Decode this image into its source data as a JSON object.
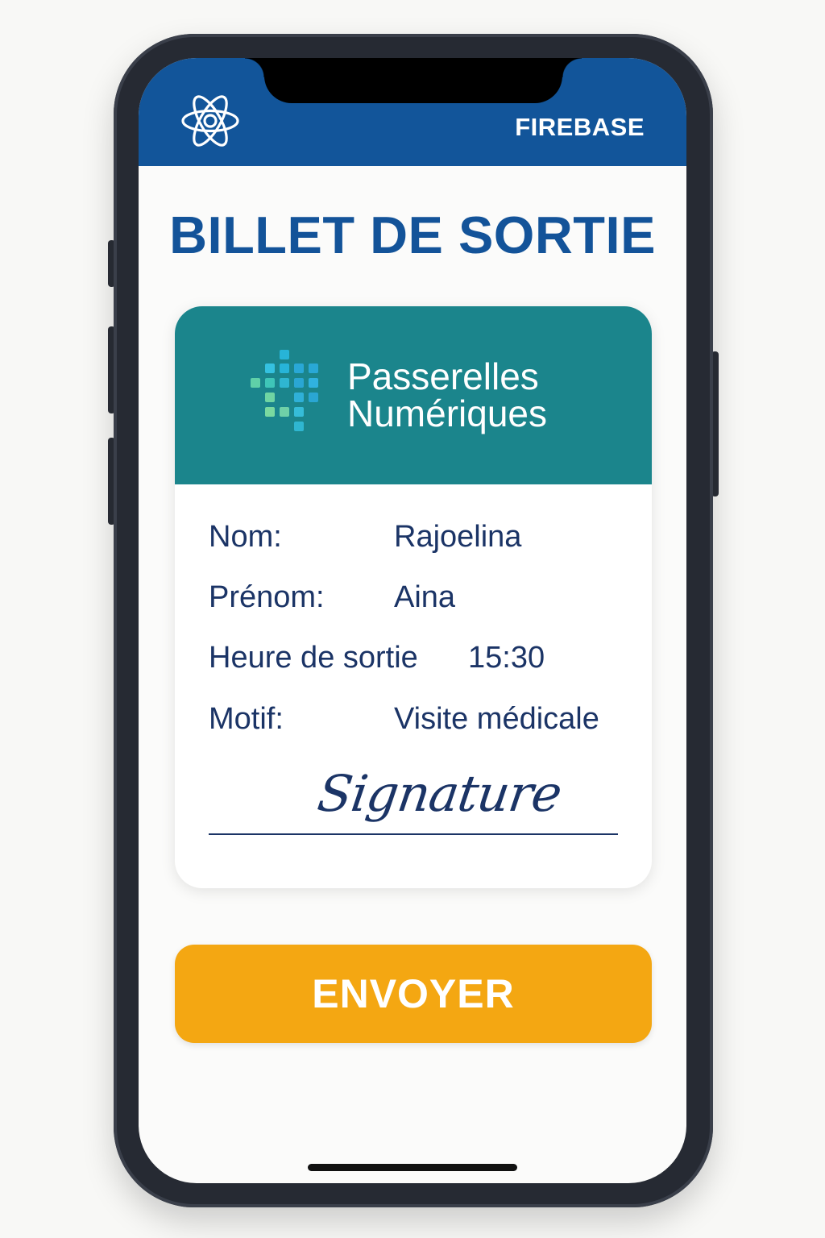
{
  "header": {
    "brand_label": "FIREBASE",
    "accent_color": "#12559a",
    "left_icon": "react-atom-icon"
  },
  "page": {
    "title": "BILLET DE SORTIE"
  },
  "card": {
    "banner_color": "#1b858c",
    "logo": {
      "line1": "Passerelles",
      "line2": "Numériques",
      "icon": "pixel-cross-logo"
    },
    "fields": [
      {
        "label": "Nom:",
        "value": "Rajoelina"
      },
      {
        "label": "Prénom:",
        "value": "Aina"
      },
      {
        "label": "Heure de sortie",
        "value": "15:30"
      },
      {
        "label": "Motif:",
        "value": "Visite médicale"
      }
    ],
    "signature": "Signature"
  },
  "actions": {
    "send_label": "ENVOYER",
    "send_color": "#f4a712"
  }
}
